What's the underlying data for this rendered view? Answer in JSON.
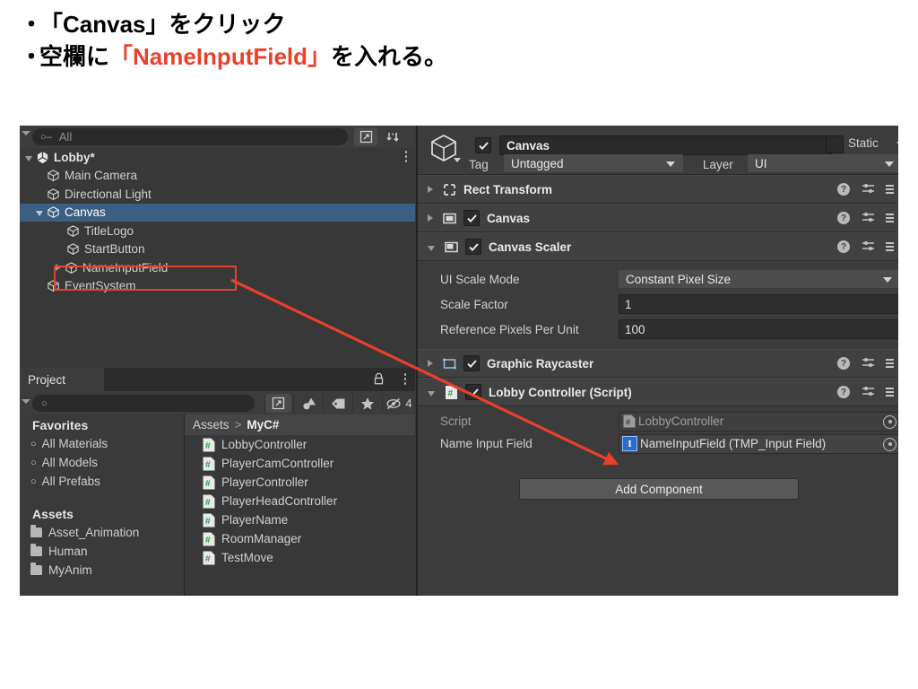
{
  "slide": {
    "bullets": [
      {
        "marker": "・",
        "text": "「Canvas」をクリック",
        "accent": ""
      },
      {
        "marker": "・",
        "pre": "空欄に",
        "accent": "「NameInputField」",
        "post": "を入れる。"
      }
    ],
    "accent_color": "#e8422a"
  },
  "hierarchy": {
    "search_placeholder": "All",
    "search_icon": "search-icon",
    "popup_icon": "popup-window-icon",
    "sort_icon": "sort-icon",
    "kebab_icon": "kebab-menu-icon",
    "rows": [
      {
        "label": "Lobby*",
        "type": "scene",
        "indent": 0,
        "expanded": true,
        "selected": false
      },
      {
        "label": "Main Camera",
        "type": "gameobject",
        "indent": 1,
        "expanded": null,
        "selected": false
      },
      {
        "label": "Directional Light",
        "type": "gameobject",
        "indent": 1,
        "expanded": null,
        "selected": false
      },
      {
        "label": "Canvas",
        "type": "gameobject",
        "indent": 1,
        "expanded": true,
        "selected": true
      },
      {
        "label": "TitleLogo",
        "type": "gameobject",
        "indent": 2,
        "expanded": null,
        "selected": false
      },
      {
        "label": "StartButton",
        "type": "gameobject",
        "indent": 2,
        "expanded": null,
        "selected": false
      },
      {
        "label": "NameInputField",
        "type": "gameobject",
        "indent": 2,
        "expanded": false,
        "selected": false
      },
      {
        "label": "EventSystem",
        "type": "gameobject",
        "indent": 1,
        "expanded": null,
        "selected": false
      }
    ]
  },
  "project": {
    "tab_label": "Project",
    "lock_icon": "lock-icon",
    "kebab_icon": "kebab-menu-icon",
    "search_placeholder": "",
    "toolbar_icons": [
      {
        "name": "popup-window-icon",
        "label": ""
      },
      {
        "name": "asset-filter-icon",
        "label": ""
      },
      {
        "name": "tag-filter-icon",
        "label": ""
      },
      {
        "name": "favorite-star-icon",
        "label": ""
      },
      {
        "name": "hidden-packages-icon",
        "label": "4"
      }
    ],
    "favorites_title": "Favorites",
    "favorites": [
      "All Materials",
      "All Models",
      "All Prefabs"
    ],
    "assets_title": "Assets",
    "folders": [
      "Asset_Animation",
      "Human",
      "MyAnim"
    ],
    "breadcrumb": {
      "root": "Assets",
      "separator": ">",
      "current": "MyC#"
    },
    "files": [
      "LobbyController",
      "PlayerCamController",
      "PlayerController",
      "PlayerHeadController",
      "PlayerName",
      "RoomManager",
      "TestMove"
    ]
  },
  "inspector": {
    "gameobject_icon": "gameobject-cube-icon",
    "active_checkbox": true,
    "name": "Canvas",
    "static_label": "Static",
    "static_checked": false,
    "tag_label": "Tag",
    "tag_value": "Untagged",
    "layer_label": "Layer",
    "layer_value": "UI",
    "components": [
      {
        "title": "Rect Transform",
        "icon": "rect-transform-icon",
        "expanded": false,
        "has_enable": false,
        "enabled": false
      },
      {
        "title": "Canvas",
        "icon": "canvas-icon",
        "expanded": false,
        "has_enable": true,
        "enabled": true
      },
      {
        "title": "Canvas Scaler",
        "icon": "canvas-scaler-icon",
        "expanded": true,
        "has_enable": true,
        "enabled": true
      }
    ],
    "canvas_scaler_props": [
      {
        "label": "UI Scale Mode",
        "value": "Constant Pixel Size",
        "kind": "dropdown"
      },
      {
        "label": "Scale Factor",
        "value": "1",
        "kind": "field"
      },
      {
        "label": "Reference Pixels Per Unit",
        "value": "100",
        "kind": "field"
      }
    ],
    "components2": [
      {
        "title": "Graphic Raycaster",
        "icon": "graphic-raycaster-icon",
        "expanded": false,
        "has_enable": true,
        "enabled": true
      },
      {
        "title": "Lobby Controller (Script)",
        "icon": "cs-script-icon",
        "expanded": true,
        "has_enable": true,
        "enabled": true
      }
    ],
    "script_props": [
      {
        "label": "Script",
        "value": "LobbyController",
        "kind": "object",
        "icon": "cs-script-icon",
        "dim": true
      },
      {
        "label": "Name Input Field",
        "value": "NameInputField (TMP_Input Field)",
        "kind": "object",
        "icon": "tmp-input-field-icon",
        "dim": false
      }
    ],
    "help_icon": "help-icon",
    "preset_icon": "preset-sliders-icon",
    "menu_icon": "component-menu-icon",
    "add_component_label": "Add Component"
  }
}
